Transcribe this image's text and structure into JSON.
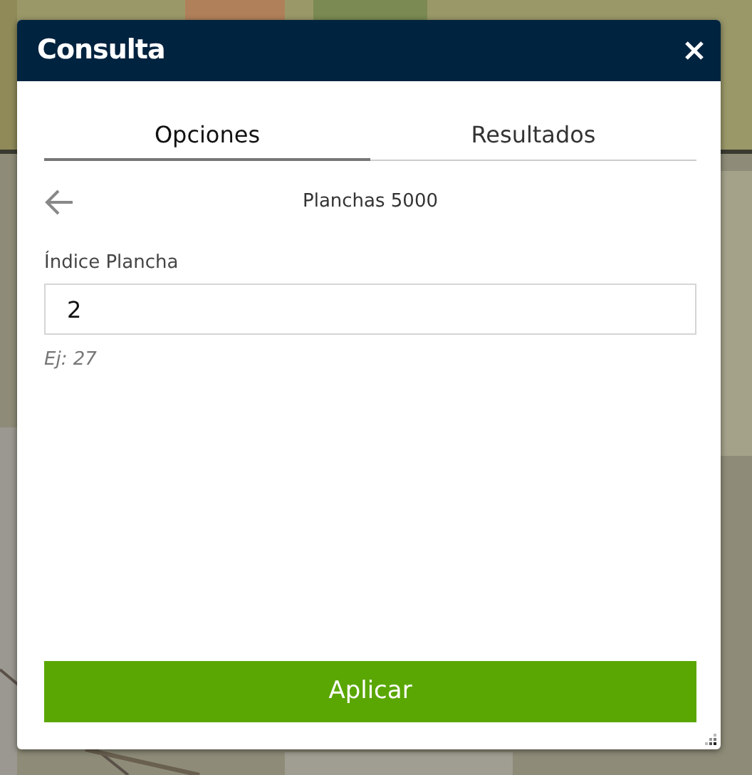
{
  "window": {
    "title": "Consulta"
  },
  "tabs": [
    {
      "label": "Opciones",
      "selected": true
    },
    {
      "label": "Resultados",
      "selected": false
    }
  ],
  "breadcrumb": {
    "title": "Planchas 5000"
  },
  "field": {
    "label": "Índice Plancha",
    "value": "2",
    "hint": "Ej: 27"
  },
  "buttons": [
    "Aplicar"
  ],
  "background": {
    "kind": "picture"
  }
}
